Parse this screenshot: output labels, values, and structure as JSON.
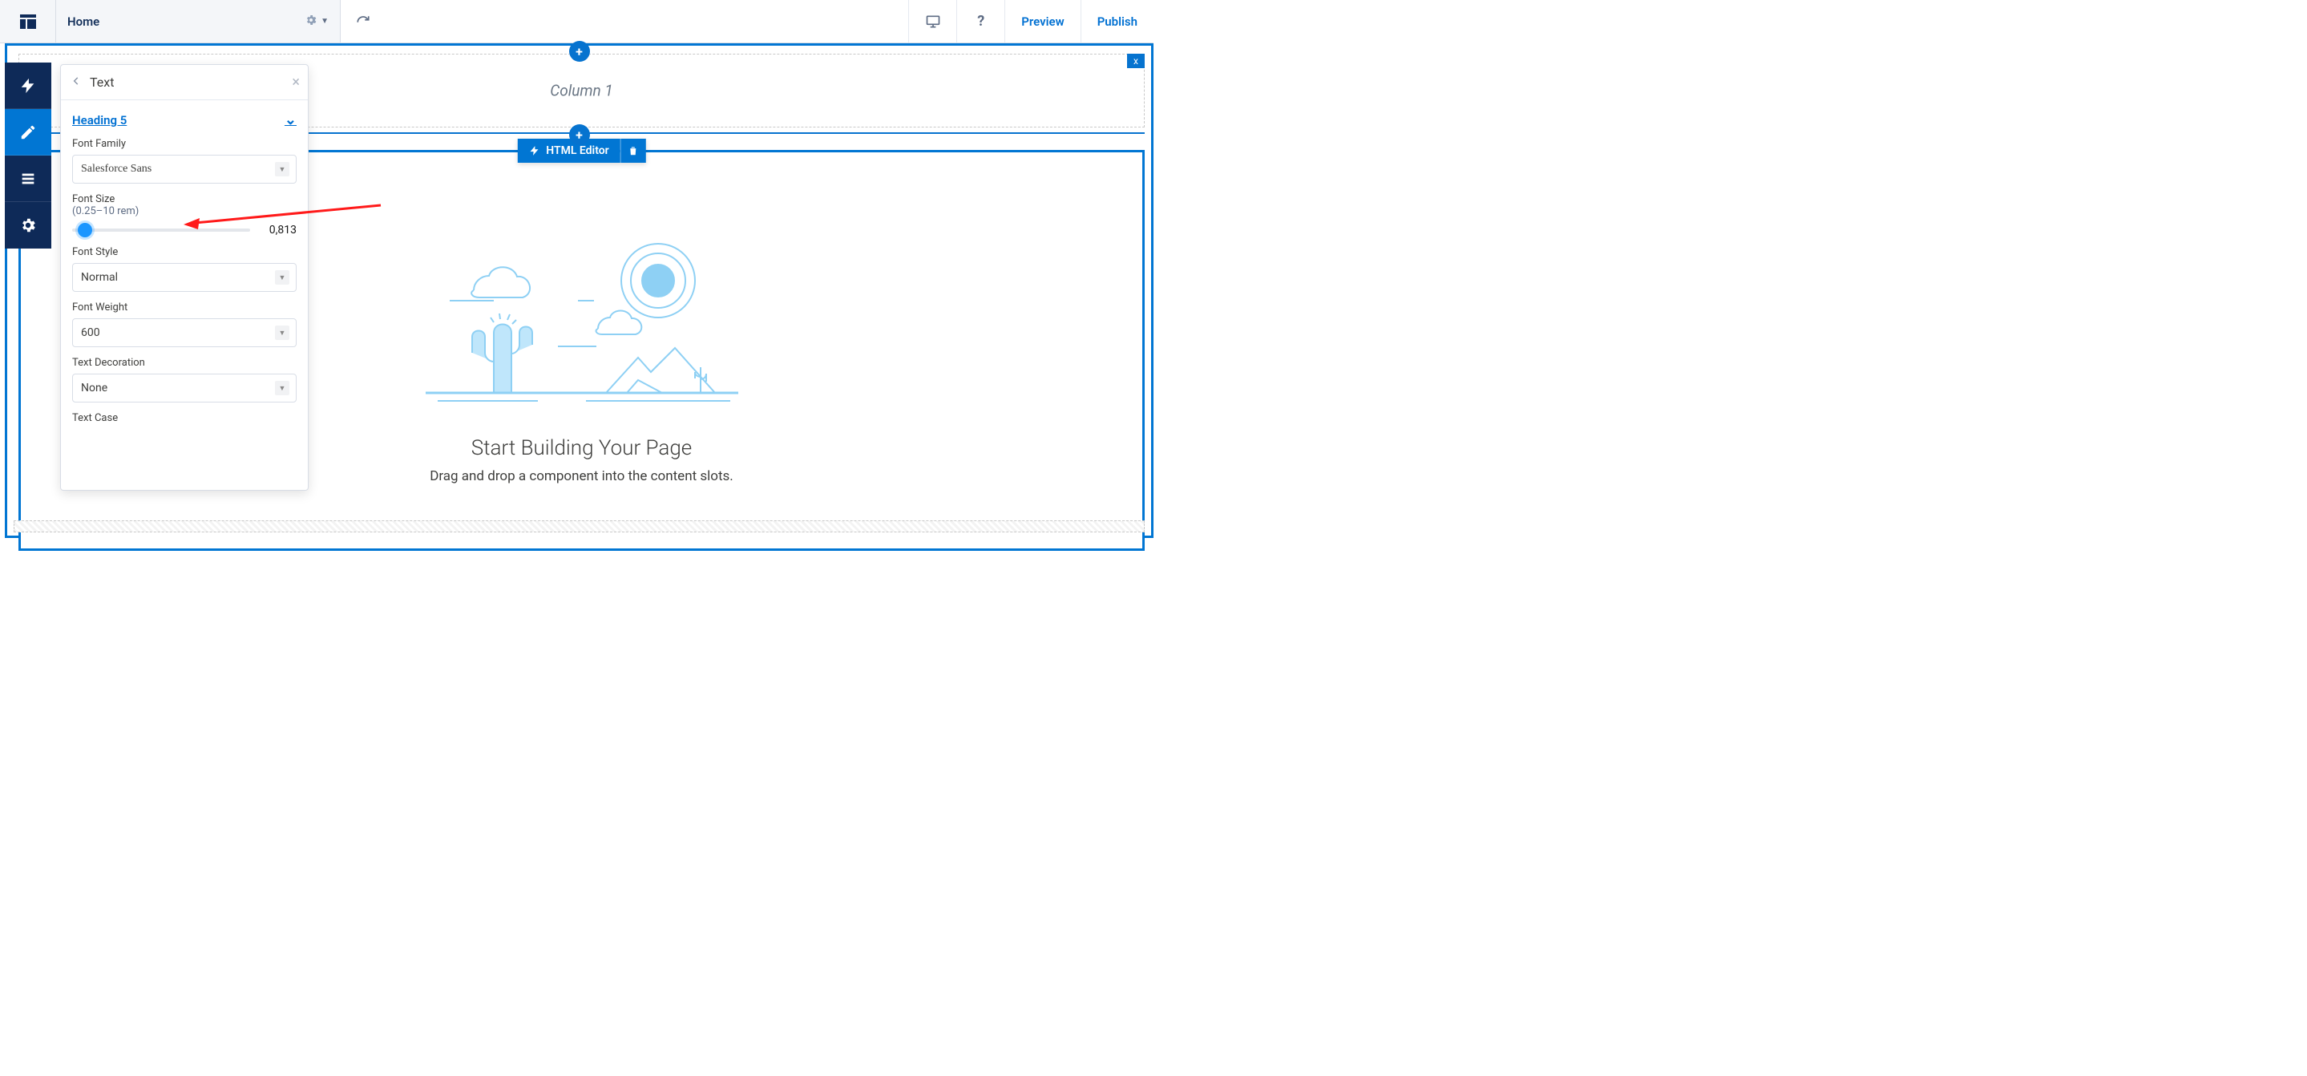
{
  "topbar": {
    "page_name": "Home",
    "preview": "Preview",
    "publish": "Publish"
  },
  "panel": {
    "title": "Text",
    "section": "Heading 5",
    "font_family_label": "Font Family",
    "font_family_value": "Salesforce Sans",
    "font_size_label": "Font Size",
    "font_size_range": "(0.25–10 rem)",
    "font_size_value": "0,813",
    "font_style_label": "Font Style",
    "font_style_value": "Normal",
    "font_weight_label": "Font Weight",
    "font_weight_value": "600",
    "text_decoration_label": "Text Decoration",
    "text_decoration_value": "None",
    "text_case_label": "Text Case"
  },
  "canvas": {
    "column_label": "Column 1",
    "component_name": "HTML Editor",
    "empty_heading": "Start Building Your Page",
    "empty_sub": "Drag and drop a component into the content slots."
  },
  "icons": {
    "bolt": "bolt-icon",
    "trash": "trash-icon"
  }
}
